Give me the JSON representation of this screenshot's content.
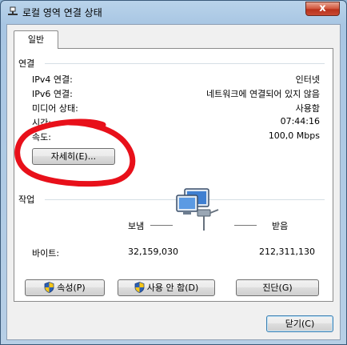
{
  "window": {
    "title": "로컬 영역 연결 상태",
    "close_label": "x"
  },
  "tab": {
    "label": "일반"
  },
  "connection": {
    "group_title": "연결",
    "rows": [
      {
        "label": "IPv4 연결:",
        "value": "인터넷"
      },
      {
        "label": "IPv6 연결:",
        "value": "네트워크에 연결되어 있지 않음"
      },
      {
        "label": "미디어 상태:",
        "value": "사용함"
      },
      {
        "label": "시간:",
        "value": "07:44:16"
      },
      {
        "label": "속도:",
        "value": "100,0 Mbps"
      }
    ],
    "details_button": "자세히(E)..."
  },
  "activity": {
    "group_title": "작업",
    "sent_label": "보냄",
    "received_label": "받음",
    "bytes_label": "바이트:",
    "bytes_sent": "32,159,030",
    "bytes_received": "212,311,130"
  },
  "buttons": {
    "properties": "속성(P)",
    "disable": "사용 안 함(D)",
    "diagnose": "진단(G)",
    "close": "닫기(C)"
  },
  "colors": {
    "annotation_red": "#e8101a",
    "titlebar": "#a8c6e3",
    "close_button": "#c94a33"
  },
  "icons": [
    "network-connection-icon",
    "network-activity-icon",
    "uac-shield-icon",
    "close-icon"
  ]
}
